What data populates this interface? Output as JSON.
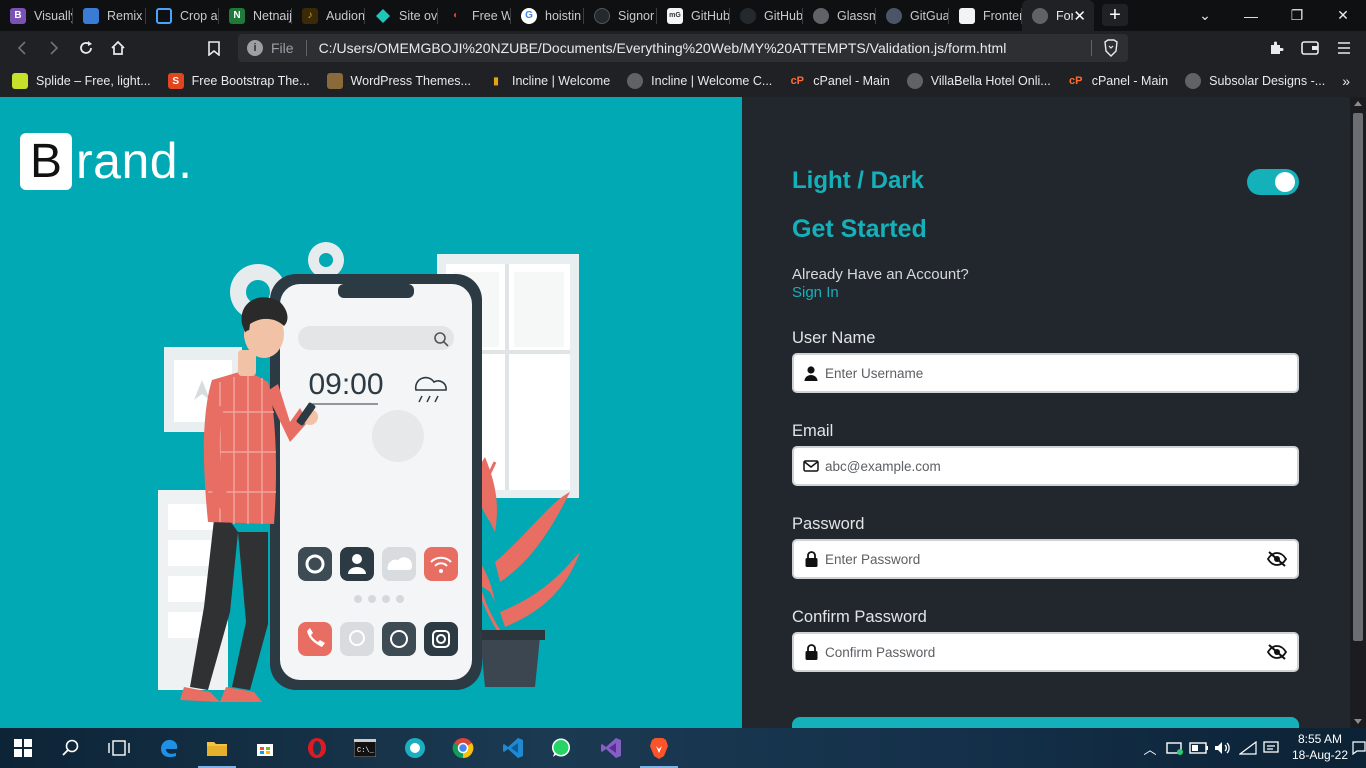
{
  "browser": {
    "tabs": [
      {
        "label": "Visually",
        "icon": "bootstrap-icon",
        "color": "#7952b3",
        "glyph": "B"
      },
      {
        "label": "Remix",
        "icon": "remix-icon",
        "color": "#3a7bd5",
        "glyph": "R"
      },
      {
        "label": "Crop a",
        "icon": "crop-icon",
        "color": "#2d7fc1",
        "glyph": ""
      },
      {
        "label": "Netnaij",
        "icon": "netnaija-icon",
        "color": "#1f7a3a",
        "glyph": "N"
      },
      {
        "label": "Audion",
        "icon": "audio-icon",
        "color": "#e6a316",
        "glyph": ""
      },
      {
        "label": "Site ov",
        "icon": "netlify-icon",
        "color": "#20c6b7",
        "glyph": ""
      },
      {
        "label": "Free W",
        "icon": "free-website-icon",
        "color": "#c62828",
        "glyph": ""
      },
      {
        "label": "hoistin",
        "icon": "google-icon",
        "color": "#ffffff",
        "glyph": "G"
      },
      {
        "label": "Signor",
        "icon": "github-icon",
        "color": "#24292e",
        "glyph": ""
      },
      {
        "label": "GitHub",
        "icon": "github-image-icon",
        "color": "#6e5494",
        "glyph": "G"
      },
      {
        "label": "GitHub",
        "icon": "github-icon",
        "color": "#24292e",
        "glyph": ""
      },
      {
        "label": "Glassm",
        "icon": "globe-icon",
        "color": "#5f6368",
        "glyph": ""
      },
      {
        "label": "GitGua",
        "icon": "gitguardian-icon",
        "color": "#4a5568",
        "glyph": ""
      },
      {
        "label": "Fronter",
        "icon": "frontend-icon",
        "color": "#f1f3f4",
        "glyph": ""
      },
      {
        "label": "For",
        "icon": "globe-icon",
        "color": "#5f6368",
        "glyph": ""
      }
    ],
    "url_scheme": "File",
    "url": "C:/Users/OMEMGBOJI%20NZUBE/Documents/Everything%20Web/MY%20ATTEMPTS/Validation.js/form.html",
    "bookmarks": [
      {
        "label": "Splide – Free, light...",
        "color": "#c6e02b",
        "glyph": ""
      },
      {
        "label": "Free Bootstrap The...",
        "color": "#e2461f",
        "glyph": "S"
      },
      {
        "label": "WordPress Themes...",
        "color": "#8a6a3b",
        "glyph": ""
      },
      {
        "label": "Incline | Welcome",
        "color": "#202124",
        "glyph": ""
      },
      {
        "label": "Incline | Welcome C...",
        "color": "#5f6368",
        "glyph": ""
      },
      {
        "label": "cPanel - Main",
        "color": "#ff6c2c",
        "glyph": "cP"
      },
      {
        "label": "VillaBella Hotel Onli...",
        "color": "#5f6368",
        "glyph": ""
      },
      {
        "label": "cPanel - Main",
        "color": "#ff6c2c",
        "glyph": "cP"
      },
      {
        "label": "Subsolar Designs -...",
        "color": "#5f6368",
        "glyph": ""
      }
    ]
  },
  "hero": {
    "logo_letter": "B",
    "logo_rest": "rand.",
    "phone_time": "09:00"
  },
  "form": {
    "theme_label": "Light / Dark",
    "theme_dark": true,
    "heading": "Get Started",
    "already_text": "Already Have an Account?",
    "signin_label": "Sign In",
    "fields": [
      {
        "label": "User Name",
        "placeholder": "Enter Username",
        "icon": "user-icon"
      },
      {
        "label": "Email",
        "placeholder": "abc@example.com",
        "icon": "envelope-icon"
      },
      {
        "label": "Password",
        "placeholder": "Enter Password",
        "icon": "lock-icon"
      },
      {
        "label": "Confirm Password",
        "placeholder": "Confirm Password",
        "icon": "lock-icon"
      }
    ]
  },
  "taskbar": {
    "apps": [
      "start-icon",
      "search-icon",
      "task-view-icon",
      "edge-icon",
      "file-explorer-icon",
      "store-icon",
      "opera-icon",
      "terminal-icon",
      "app-icon",
      "chrome-icon",
      "vscode-icon",
      "whatsapp-icon",
      "visual-studio-icon",
      "brave-icon"
    ],
    "time": "8:55 AM",
    "date": "18-Aug-22"
  },
  "colors": {
    "accent": "#14b1bb",
    "hero_bg": "#00a9b4",
    "panel_bg": "#22272d"
  }
}
